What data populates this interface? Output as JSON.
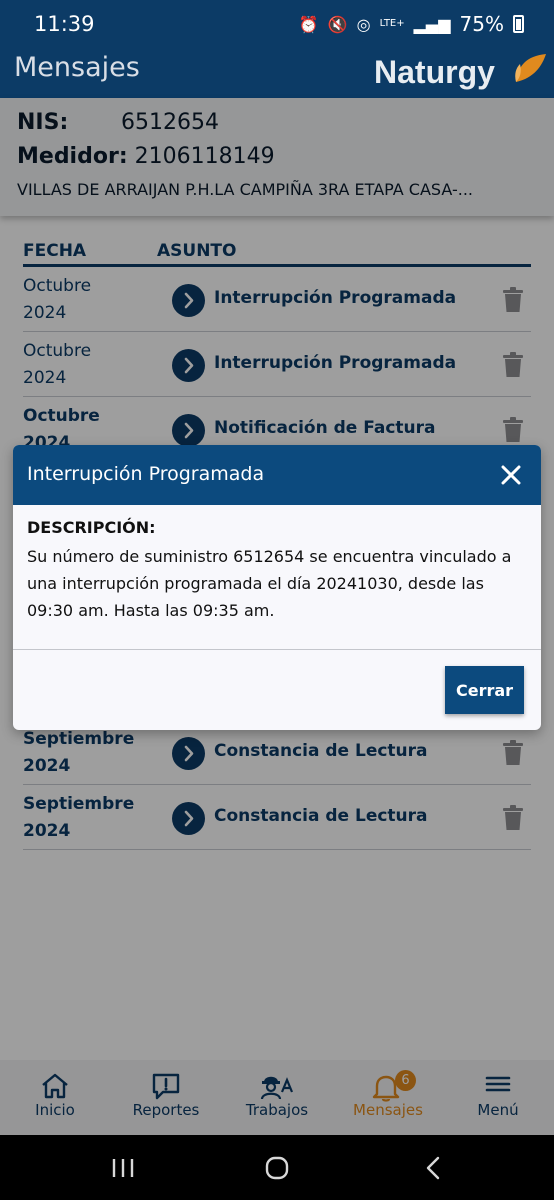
{
  "status_bar": {
    "time": "11:39",
    "battery": "75%",
    "network": "LTE+"
  },
  "header": {
    "title": "Mensajes",
    "brand": "Naturgy"
  },
  "account": {
    "nis_label": "NIS:",
    "nis_value": "6512654",
    "meter_label": "Medidor:",
    "meter_value": "2106118149",
    "address": "VILLAS DE ARRAIJAN P.H.LA CAMPIÑA 3RA ETAPA CASA-..."
  },
  "table": {
    "col_date": "FECHA",
    "col_subject": "ASUNTO",
    "rows": [
      {
        "month": "Octubre",
        "year": "2024",
        "subject": "Interrupción Programada"
      },
      {
        "month": "Octubre",
        "year": "2024",
        "subject": "Interrupción Programada"
      },
      {
        "month": "Octubre",
        "year": "2024",
        "subject": "Notificación de Factura"
      },
      {
        "month": "Septiembre",
        "year": "2024",
        "subject": "Constancia de Lectura"
      },
      {
        "month": "Septiembre",
        "year": "2024",
        "subject": "Constancia de Lectura"
      }
    ]
  },
  "modal": {
    "title": "Interrupción Programada",
    "desc_label": "DESCRIPCIÓN:",
    "desc_text": "Su número de suministro 6512654 se encuentra vinculado a una interrupción programada el día 20241030, desde las 09:30 am. Hasta las  09:35 am.",
    "close_button": "Cerrar"
  },
  "bottom_nav": {
    "items": [
      {
        "label": "Inicio",
        "icon": "home-icon"
      },
      {
        "label": "Reportes",
        "icon": "report-icon"
      },
      {
        "label": "Trabajos",
        "icon": "worker-icon"
      },
      {
        "label": "Mensajes",
        "icon": "bell-icon",
        "badge": "6"
      },
      {
        "label": "Menú",
        "icon": "hamburger-icon"
      }
    ]
  },
  "colors": {
    "primary": "#0c3b66",
    "accent": "#e08a1e",
    "modal_header": "#0c4a7e"
  }
}
